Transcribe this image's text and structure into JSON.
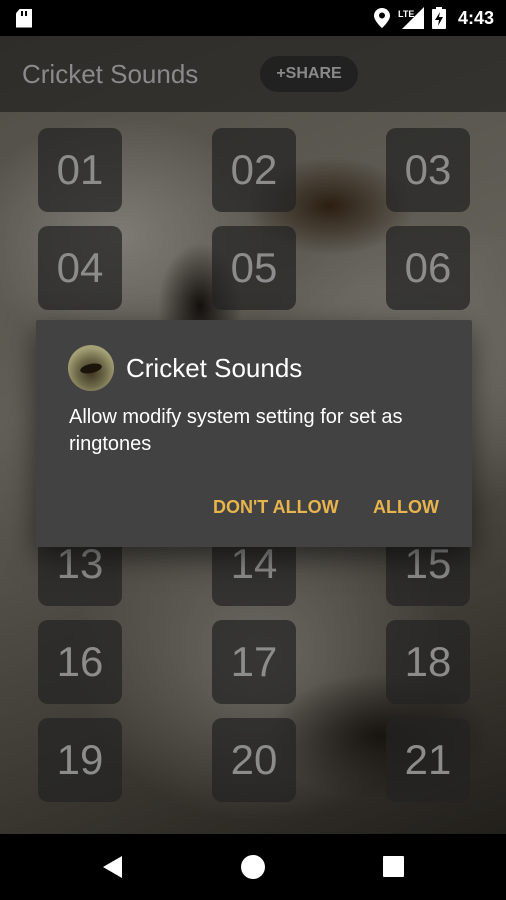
{
  "status_bar": {
    "time": "4:43",
    "network": "LTE",
    "icons": [
      "sd-card-icon",
      "location-icon",
      "signal-icon",
      "battery-charging-icon"
    ]
  },
  "app": {
    "title": "Cricket Sounds",
    "share_label": "+SHARE"
  },
  "tiles": [
    "01",
    "02",
    "03",
    "04",
    "05",
    "06",
    "13",
    "14",
    "15",
    "16",
    "17",
    "18",
    "19",
    "20",
    "21"
  ],
  "dialog": {
    "title": "Cricket Sounds",
    "message": "Allow modify system setting for set as ringtones",
    "negative_label": "DON'T ALLOW",
    "positive_label": "ALLOW",
    "accent_color": "#e8b44e"
  },
  "nav_bar": {
    "icons": [
      "back-icon",
      "home-icon",
      "recents-icon"
    ]
  }
}
